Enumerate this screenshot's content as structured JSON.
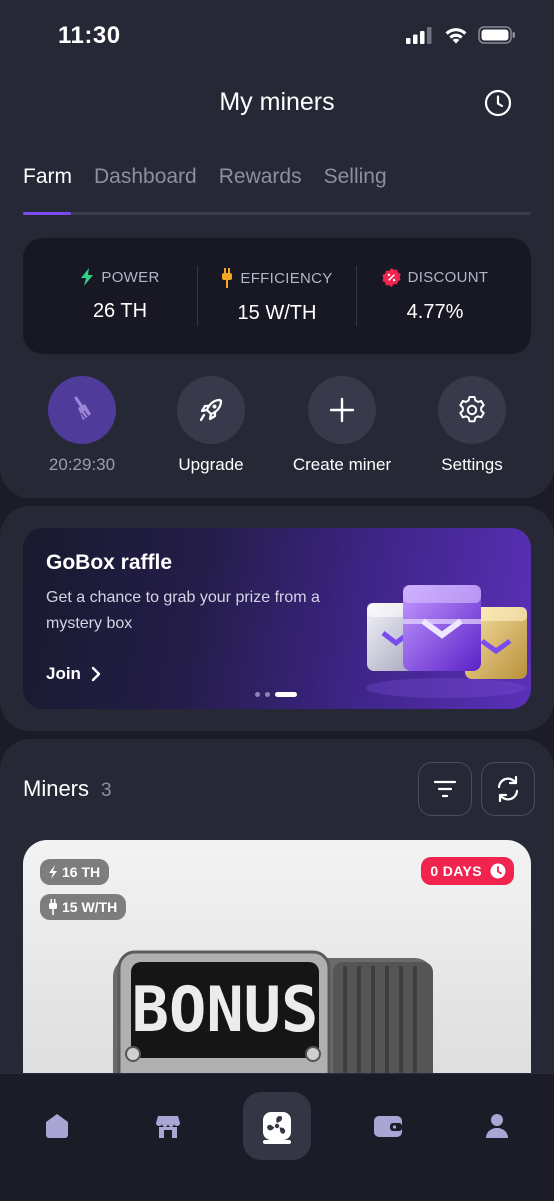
{
  "status_bar": {
    "time": "11:30"
  },
  "header": {
    "title": "My miners",
    "history_icon": "clock-icon"
  },
  "tabs": [
    {
      "label": "Farm",
      "active": true
    },
    {
      "label": "Dashboard",
      "active": false
    },
    {
      "label": "Rewards",
      "active": false
    },
    {
      "label": "Selling",
      "active": false
    }
  ],
  "stats": {
    "power": {
      "label": "POWER",
      "value": "26 TH",
      "icon": "lightning-icon",
      "color": "#2fd08a"
    },
    "efficiency": {
      "label": "EFFICIENCY",
      "value": "15 W/TH",
      "icon": "plug-icon",
      "color": "#f5a623"
    },
    "discount": {
      "label": "DISCOUNT",
      "value": "4.77%",
      "icon": "discount-badge-icon",
      "color": "#f0244f"
    }
  },
  "actions": [
    {
      "label": "20:29:30",
      "icon": "broom-icon"
    },
    {
      "label": "Upgrade",
      "icon": "rocket-icon"
    },
    {
      "label": "Create miner",
      "icon": "plus-icon"
    },
    {
      "label": "Settings",
      "icon": "gear-icon"
    }
  ],
  "banner": {
    "title": "GoBox raffle",
    "description": "Get a chance to grab your prize from a mystery box",
    "join_label": "Join",
    "page_index": 3,
    "page_count": 3
  },
  "miners": {
    "title": "Miners",
    "count": "3",
    "filter_icon": "filter-icon",
    "refresh_icon": "refresh-icon"
  },
  "miner_card": {
    "power": "16 TH",
    "efficiency": "15 W/TH",
    "days_badge": "0 DAYS",
    "screen_text": "BONUS"
  },
  "bottom_nav": [
    {
      "icon": "home-icon",
      "active": false
    },
    {
      "icon": "store-icon",
      "active": false
    },
    {
      "icon": "fan-icon",
      "active": true
    },
    {
      "icon": "wallet-icon",
      "active": false
    },
    {
      "icon": "profile-icon",
      "active": false
    }
  ],
  "colors": {
    "accent": "#7a4cf0",
    "background": "#1b1c27",
    "surface": "#262836",
    "danger": "#f0244f"
  }
}
